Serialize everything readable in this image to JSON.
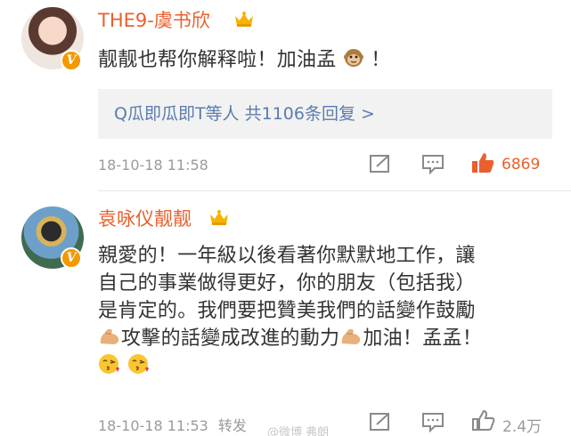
{
  "comments": [
    {
      "username": "THE9-虞书欣",
      "text": "靓靓也帮你解释啦！加油孟",
      "text_suffix": "！",
      "reply_summary": "Q瓜即瓜即T等人  共1106条回复 >",
      "timestamp": "18-10-18 11:58",
      "repost_label": "",
      "like_count": "6869",
      "liked": true
    },
    {
      "username": "袁咏仪靓靓",
      "text_lines": [
        "親愛的！一年級以後看著你默默地工作，讓",
        "自己的事業做得更好，你的朋友（包括我）",
        "是肯定的。我們要把贊美我們的話變作鼓勵"
      ],
      "text_line4_a": "攻擊的話變成改進的動力",
      "text_line4_b": "加油！孟孟！",
      "timestamp": "18-10-18 11:53",
      "repost_label": "转发",
      "like_count": "2.4万",
      "liked": false
    }
  ],
  "watermark": "@微博 弗朗",
  "icons": {
    "verified": "V",
    "crown": "crown-icon",
    "repost": "repost-icon",
    "comment": "comment-icon",
    "like": "thumbs-up-icon",
    "monkey": "monkey-emoji",
    "muscle": "flexed-biceps-emoji",
    "kiss": "kissing-face-emoji"
  },
  "colors": {
    "username": "#e8602e",
    "link": "#5b7cae",
    "liked": "#e8602e",
    "meta": "#9a9a9a",
    "badge": "#f29900"
  }
}
